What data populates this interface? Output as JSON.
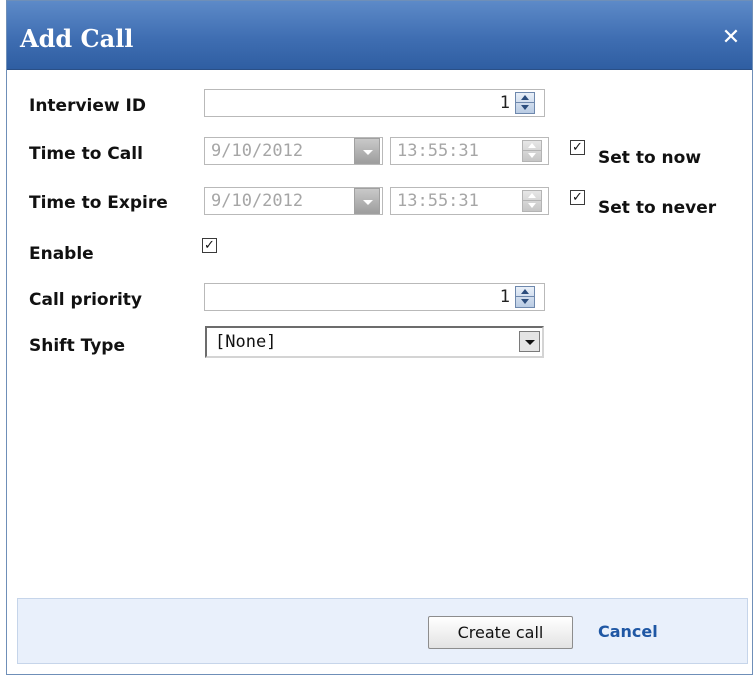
{
  "dialog": {
    "title": "Add Call",
    "close_glyph": "✕"
  },
  "form": {
    "interview_id": {
      "label": "Interview ID",
      "value": "1"
    },
    "time_to_call": {
      "label": "Time to Call",
      "date": "9/10/2012",
      "time": "13:55:31",
      "checkbox_label": "Set to now",
      "checked": true
    },
    "time_to_expire": {
      "label": "Time to Expire",
      "date": "9/10/2012",
      "time": "13:55:31",
      "checkbox_label": "Set to never",
      "checked": true
    },
    "enable": {
      "label": "Enable",
      "checked": true
    },
    "call_priority": {
      "label": "Call priority",
      "value": "1"
    },
    "shift_type": {
      "label": "Shift Type",
      "value": "[None]"
    }
  },
  "footer": {
    "create_label": "Create call",
    "cancel_label": "Cancel"
  },
  "check_glyph": "✓",
  "colors": {
    "titlebar": "#3f6eb2",
    "footer_bg": "#e9f0fb",
    "link": "#1f57a4"
  }
}
